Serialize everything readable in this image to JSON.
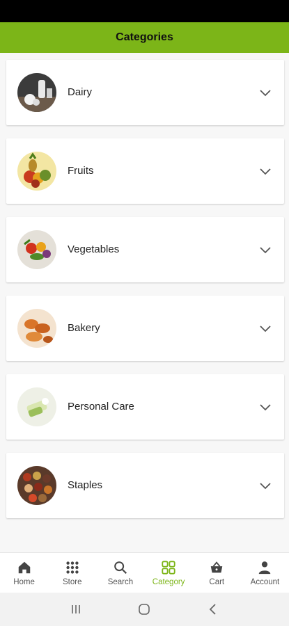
{
  "header": {
    "title": "Categories"
  },
  "categories": [
    {
      "label": "Dairy",
      "icon": "dairy-photo"
    },
    {
      "label": "Fruits",
      "icon": "fruits-photo"
    },
    {
      "label": "Vegetables",
      "icon": "vegetables-photo"
    },
    {
      "label": "Bakery",
      "icon": "bakery-photo"
    },
    {
      "label": "Personal Care",
      "icon": "personal-care-photo"
    },
    {
      "label": "Staples",
      "icon": "staples-photo"
    }
  ],
  "bottom_nav": [
    {
      "label": "Home",
      "icon": "home-icon",
      "active": false
    },
    {
      "label": "Store",
      "icon": "grid-icon",
      "active": false
    },
    {
      "label": "Search",
      "icon": "search-icon",
      "active": false
    },
    {
      "label": "Category",
      "icon": "category-icon",
      "active": true
    },
    {
      "label": "Cart",
      "icon": "basket-icon",
      "active": false
    },
    {
      "label": "Account",
      "icon": "person-icon",
      "active": false
    }
  ],
  "colors": {
    "accent": "#7cb518",
    "status_bar": "#000000"
  }
}
